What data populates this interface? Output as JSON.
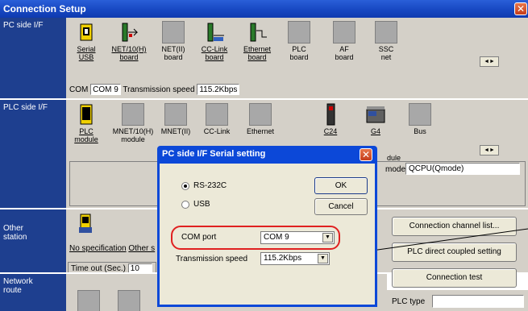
{
  "window": {
    "title": "Connection Setup"
  },
  "pc_side": {
    "label": "PC side I/F",
    "icons": [
      {
        "line1": "Serial",
        "line2": "USB",
        "underline": true
      },
      {
        "line1": "NET/10(H)",
        "line2": "board",
        "underline": true
      },
      {
        "line1": "NET(II)",
        "line2": "board",
        "underline": false
      },
      {
        "line1": "CC-Link",
        "line2": "board",
        "underline": true
      },
      {
        "line1": "Ethernet",
        "line2": "board",
        "underline": true
      },
      {
        "line1": "PLC",
        "line2": "board",
        "underline": false
      },
      {
        "line1": "AF",
        "line2": "board",
        "underline": false
      },
      {
        "line1": "SSC",
        "line2": "net",
        "underline": false
      }
    ],
    "com_label": "COM",
    "com_value": "COM 9",
    "speed_label": "Transmission speed",
    "speed_value": "115.2Kbps"
  },
  "plc_side": {
    "label": "PLC side I/F",
    "icons": [
      {
        "line1": "PLC",
        "line2": "module",
        "underline": true
      },
      {
        "line1": "MNET/10(H)",
        "line2": "module",
        "underline": false
      },
      {
        "line1": "MNET(II)",
        "line2": "",
        "underline": false
      },
      {
        "line1": "CC-Link",
        "line2": "",
        "underline": false
      },
      {
        "line1": "Ethernet",
        "line2": "",
        "underline": false
      },
      {
        "line1": "C24",
        "line2": "",
        "underline": true
      },
      {
        "line1": "G4",
        "line2": "dule",
        "underline": true
      },
      {
        "line1": "Bus",
        "line2": "",
        "underline": false
      }
    ],
    "mode_label": "mode",
    "mode_value": "QCPU(Qmode)"
  },
  "other_station": {
    "label_line1": "Other",
    "label_line2": "station",
    "no_spec": "No specification",
    "other_partial": "Other s",
    "timeout_label": "Time out (Sec.)",
    "timeout_value": "10"
  },
  "network_route": {
    "label_line1": "Network",
    "label_line2": "route"
  },
  "buttons": {
    "channel_list": "Connection channel list...",
    "direct_coupled": "PLC direct coupled setting",
    "connection_test": "Connection test",
    "plc_type_label": "PLC type"
  },
  "dialog": {
    "title": "PC side I/F  Serial setting",
    "rs232c": "RS-232C",
    "usb": "USB",
    "ok": "OK",
    "cancel": "Cancel",
    "com_port_label": "COM port",
    "com_port_value": "COM 9",
    "speed_label": "Transmission speed",
    "speed_value": "115.2Kbps",
    "selected": "RS-232C"
  },
  "colors": {
    "title_blue": "#1646c0",
    "highlight_red": "#e02020",
    "side_blue": "#1e3f8f"
  }
}
